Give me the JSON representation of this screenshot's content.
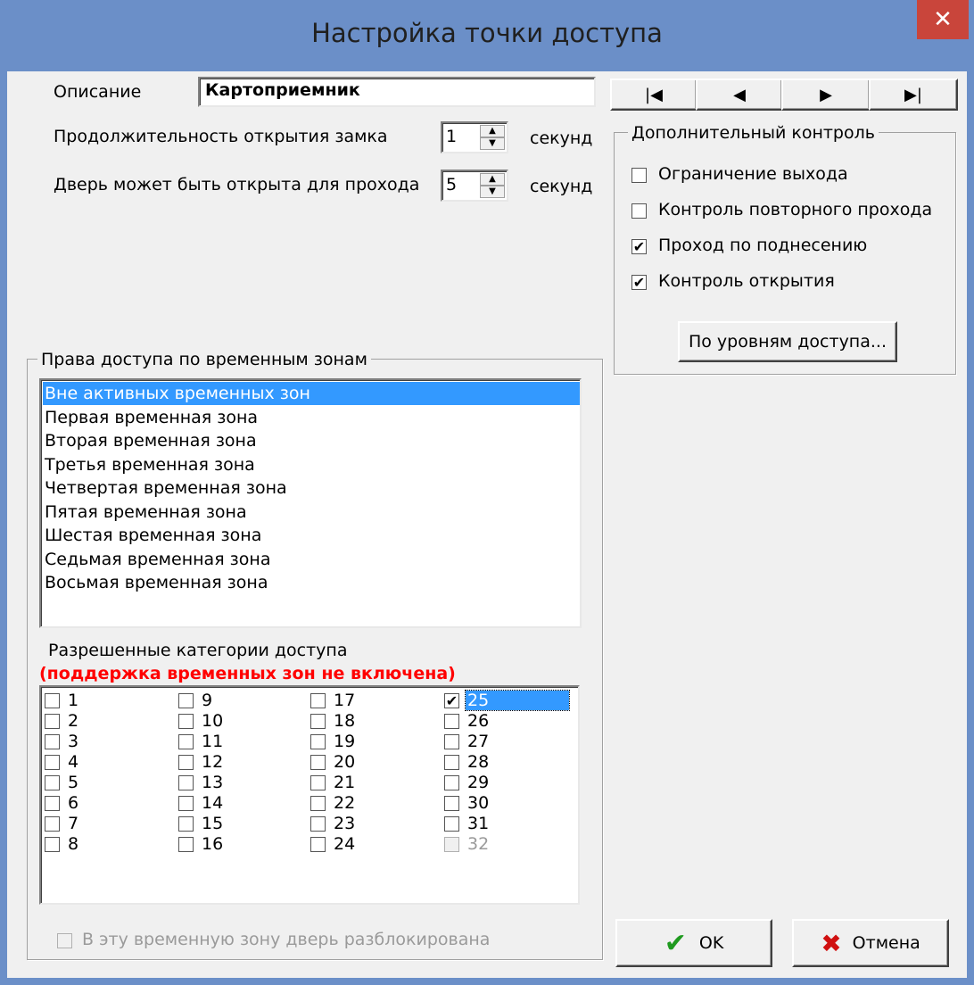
{
  "window": {
    "title": "Настройка точки доступа",
    "close_glyph": "✕"
  },
  "description": {
    "label": "Описание",
    "value": "Картоприемник"
  },
  "lock_duration": {
    "label": "Продолжительность открытия замка",
    "value": "1",
    "unit": "секунд"
  },
  "door_open": {
    "label": "Дверь может быть открыта для прохода",
    "value": "5",
    "unit": "секунд"
  },
  "nav_buttons": [
    {
      "name": "first",
      "glyph": "|◀"
    },
    {
      "name": "prev",
      "glyph": "◀"
    },
    {
      "name": "next",
      "glyph": "▶"
    },
    {
      "name": "last",
      "glyph": "▶|"
    }
  ],
  "extra_control": {
    "title": "Дополнительный контроль",
    "options": [
      {
        "label": "Ограничение выхода",
        "checked": false
      },
      {
        "label": "Контроль повторного прохода",
        "checked": false
      },
      {
        "label": "Проход по поднесению",
        "checked": true
      },
      {
        "label": "Контроль открытия",
        "checked": true
      }
    ],
    "levels_button": "По уровням доступа..."
  },
  "timezones": {
    "title": "Права доступа по временным зонам",
    "items": [
      "Вне активных временных зон",
      "Первая временная зона",
      "Вторая временная зона",
      "Третья временная зона",
      "Четвертая временная зона",
      "Пятая временная зона",
      "Шестая временная зона",
      "Седьмая временная зона",
      "Восьмая временная зона"
    ],
    "selected_index": 0
  },
  "categories": {
    "label": "Разрешенные категории доступа",
    "warning": "(поддержка временных зон не включена)",
    "items": [
      "1",
      "2",
      "3",
      "4",
      "5",
      "6",
      "7",
      "8",
      "9",
      "10",
      "11",
      "12",
      "13",
      "14",
      "15",
      "16",
      "17",
      "18",
      "19",
      "20",
      "21",
      "22",
      "23",
      "24",
      "25",
      "26",
      "27",
      "28",
      "29",
      "30",
      "31",
      "32"
    ],
    "checked": [
      "25"
    ],
    "selected": "25",
    "disabled": [
      "32"
    ]
  },
  "unlock_checkbox": {
    "label": "В эту временную зону дверь разблокирована",
    "checked": false,
    "enabled": false
  },
  "buttons": {
    "ok": "OK",
    "cancel": "Отмена"
  },
  "glyphs": {
    "check": "✔",
    "spin_up": "▲",
    "spin_down": "▼",
    "ok_icon": "✔",
    "cancel_icon": "✖"
  }
}
